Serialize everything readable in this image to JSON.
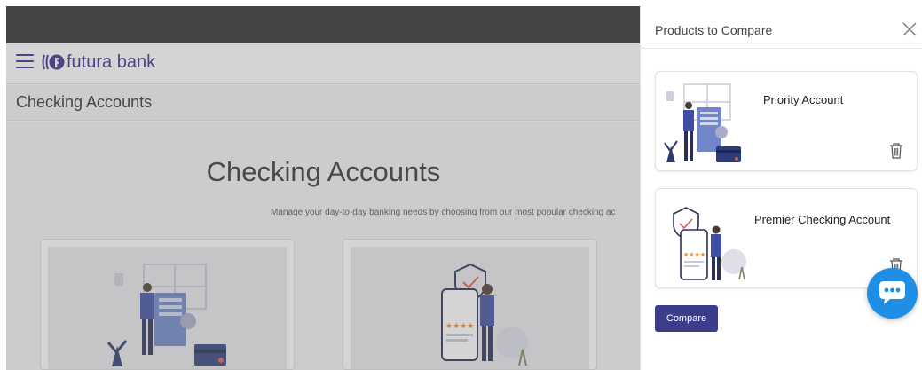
{
  "header": {
    "brand": "futura bank",
    "menu_icon": "hamburger-menu-icon",
    "logo_icon": "futura-bank-logo-icon"
  },
  "subheader": {
    "title": "Checking Accounts"
  },
  "main": {
    "title": "Checking Accounts",
    "subtitle": "Manage your day-to-day banking needs by choosing from our most popular checking ac"
  },
  "drawer": {
    "title": "Products to Compare",
    "close_icon": "close-icon",
    "products": [
      {
        "name": "Priority Account",
        "image": "person-with-document-illustration",
        "delete_icon": "trash-icon"
      },
      {
        "name": "Premier Checking Account",
        "image": "phone-with-shield-illustration",
        "delete_icon": "trash-icon"
      }
    ],
    "compare_label": "Compare"
  },
  "chat": {
    "icon": "chat-bubble-icon"
  },
  "colors": {
    "brand": "#3b2a8c",
    "topbar": "#2b2b2f",
    "button": "#3a3d8c",
    "chat": "#1f8fe6"
  }
}
